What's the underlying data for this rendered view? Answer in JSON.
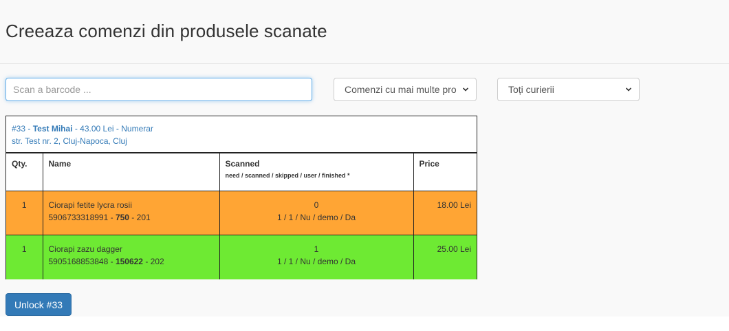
{
  "page": {
    "title": "Creeaza comenzi din produsele scanate"
  },
  "scan": {
    "placeholder": "Scan a barcode ...",
    "value": ""
  },
  "filters": {
    "orders_select": "Comenzi cu mai multe pro",
    "couriers_select": "Toți curierii"
  },
  "order": {
    "number": "#33",
    "customer": "Test Mihai",
    "total": "43.00 Lei",
    "payment": "Numerar",
    "address": "str. Test nr. 2, Cluj-Napoca, Cluj",
    "columns": {
      "qty": "Qty.",
      "name": "Name",
      "scanned": "Scanned",
      "scanned_sub": "need / scanned / skipped / user / finished *",
      "price": "Price"
    },
    "items": [
      {
        "qty": "1",
        "name": "Ciorapi fetite lycra rosii",
        "barcode": "5906733318991",
        "code": "750",
        "ref": "201",
        "scanned_count": "0",
        "scan_detail": "1 / 1 / Nu / demo / Da",
        "price": "18.00 Lei",
        "status_color": "#ffa534"
      },
      {
        "qty": "1",
        "name": "Ciorapi zazu dagger",
        "barcode": "5905168853848",
        "code": "150622",
        "ref": "202",
        "scanned_count": "1",
        "scan_detail": "1 / 1 / Nu / demo / Da",
        "price": "25.00 Lei",
        "status_color": "#6eea33"
      }
    ]
  },
  "actions": {
    "unlock_label": "Unlock #33"
  },
  "colors": {
    "link_blue": "#337ab7",
    "primary_button": "#337ab7",
    "row_pending": "#ffa534",
    "row_done": "#6eea33"
  }
}
